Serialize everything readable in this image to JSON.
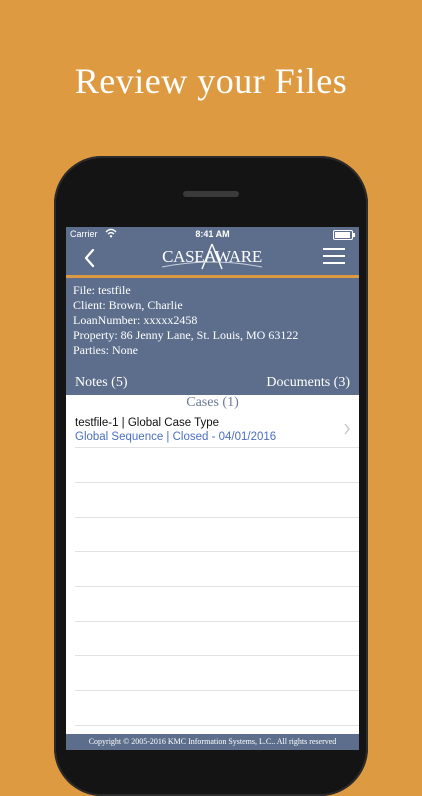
{
  "headline": "Review your Files",
  "status_bar": {
    "carrier": "Carrier",
    "time": "8:41 AM",
    "wifi_icon": "wifi-icon",
    "battery_icon": "battery-icon"
  },
  "nav": {
    "back_icon": "chevron-left-icon",
    "logo_text": "CASEAWARE",
    "menu_icon": "hamburger-menu-icon"
  },
  "file_info": {
    "file": "File: testfile",
    "client": "Client: Brown, Charlie",
    "loan_number": "LoanNumber: xxxxx2458",
    "property": "Property: 86 Jenny Lane, St. Louis, MO 63122",
    "parties": "Parties: None"
  },
  "tabs": {
    "notes": "Notes (5)",
    "documents": "Documents (3)"
  },
  "cases": {
    "header": "Cases (1)",
    "items": [
      {
        "title": "testfile-1 | Global Case Type",
        "subtitle": "Global Sequence | Closed - 04/01/2016"
      }
    ]
  },
  "footer": "Copyright © 2005-2016 KMC Information Systems, L.C.. All rights reserved",
  "colors": {
    "background": "#dd9a41",
    "nav": "#5d6e8c",
    "accent_orange": "#dd9a41",
    "link_blue": "#4a6fc2"
  }
}
